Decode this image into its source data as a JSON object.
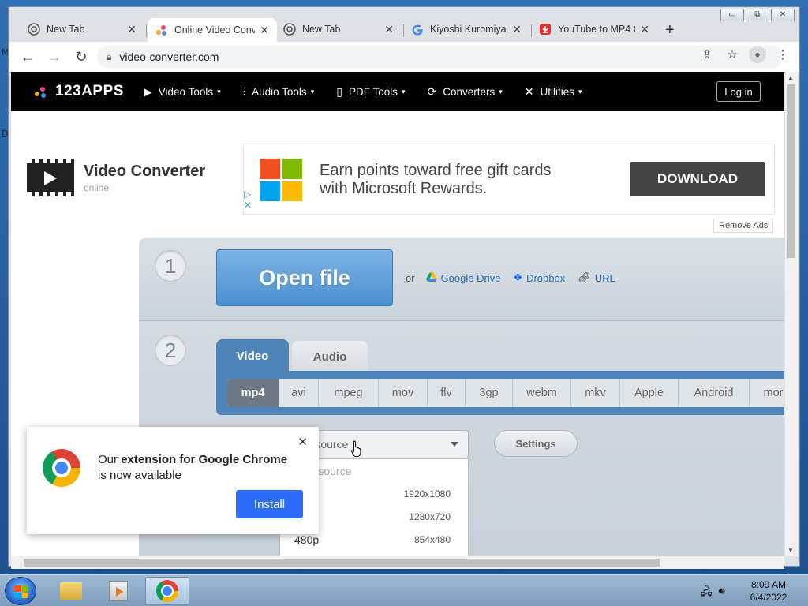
{
  "desktop": {
    "glyph_top": "M",
    "glyph_mid": "D"
  },
  "window": {
    "minimize": "▭",
    "restore": "⧉",
    "close": "✕"
  },
  "tabs": [
    {
      "title": "New Tab",
      "icon": "chrome-icon"
    },
    {
      "title": "Online Video Conv",
      "icon": "123apps-icon",
      "active": true
    },
    {
      "title": "New Tab",
      "icon": "chrome-icon"
    },
    {
      "title": "Kiyoshi Kuromiya",
      "icon": "google-icon"
    },
    {
      "title": "YouTube to MP4 C",
      "icon": "download-icon"
    }
  ],
  "toolbar": {
    "url": "video-converter.com"
  },
  "site": {
    "logo": "123APPS",
    "menu": [
      {
        "label": "Video Tools",
        "icon": "play-box-icon"
      },
      {
        "label": "Audio Tools",
        "icon": "waveform-icon"
      },
      {
        "label": "PDF Tools",
        "icon": "document-icon"
      },
      {
        "label": "Converters",
        "icon": "convert-icon"
      },
      {
        "label": "Utilities",
        "icon": "tools-icon"
      }
    ],
    "login": "Log in"
  },
  "brand": {
    "title": "Video Converter",
    "subtitle": "online"
  },
  "ad": {
    "line1": "Earn points toward free gift cards",
    "line2": "with Microsoft Rewards.",
    "button": "DOWNLOAD",
    "remove": "Remove Ads"
  },
  "converter": {
    "step1": "1",
    "step2": "2",
    "open_file": "Open file",
    "or": "or",
    "sources": [
      {
        "label": "Google Drive",
        "icon": "google-drive-icon"
      },
      {
        "label": "Dropbox",
        "icon": "dropbox-icon"
      },
      {
        "label": "URL",
        "icon": "link-icon"
      }
    ],
    "tab_video": "Video",
    "tab_audio": "Audio",
    "formats": [
      "mp4",
      "avi",
      "mpeg",
      "mov",
      "flv",
      "3gp",
      "webm",
      "mkv",
      "Apple",
      "Android",
      "mor"
    ],
    "selected_format": "mp4",
    "resolution_value": "e as source",
    "settings": "Settings",
    "dropdown": [
      {
        "label": "e as source",
        "res": "",
        "muted": true
      },
      {
        "label": "080p",
        "res": "1920x1080"
      },
      {
        "label": "20p",
        "res": "1280x720"
      },
      {
        "label": "480p",
        "res": "854x480"
      }
    ]
  },
  "popup": {
    "text_pre": "Our ",
    "text_bold": "extension for Google Chrome",
    "text_post": " is now available",
    "install": "Install"
  },
  "taskbar": {
    "time": "8:09 AM",
    "date": "6/4/2022"
  },
  "colors": {
    "accent_blue": "#4f84b8",
    "open_file_blue": "#5a9bd8",
    "install_blue": "#2d6cf6",
    "site_nav_bg": "#000000",
    "ad_button": "#444444"
  }
}
